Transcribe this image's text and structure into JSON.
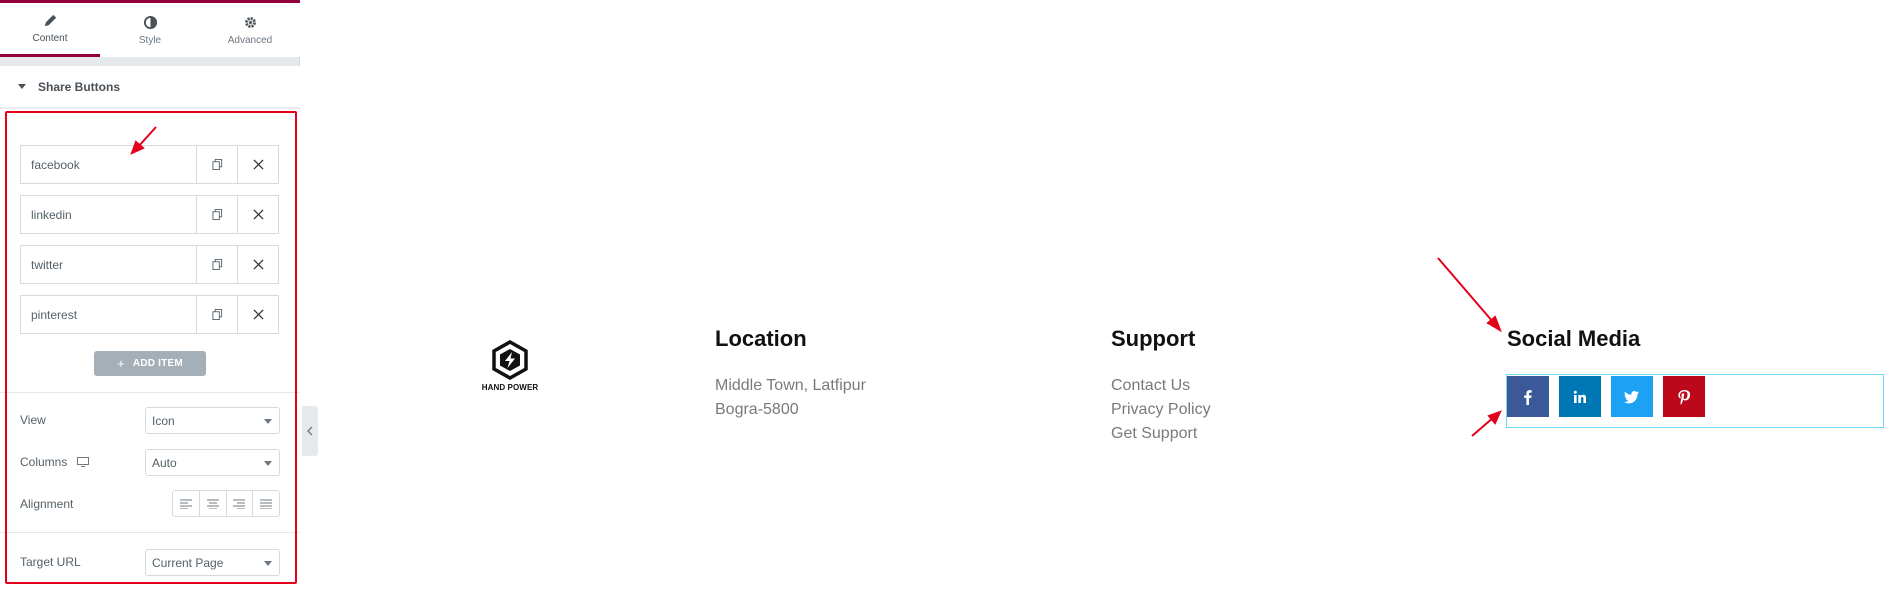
{
  "panel": {
    "tabs": [
      {
        "label": "Content",
        "icon": "pencil-icon",
        "active": true
      },
      {
        "label": "Style",
        "icon": "half-circle-icon",
        "active": false
      },
      {
        "label": "Advanced",
        "icon": "gear-icon",
        "active": false
      }
    ],
    "section_title": "Share Buttons",
    "repeater_items": [
      "facebook",
      "linkedin",
      "twitter",
      "pinterest"
    ],
    "add_item_label": "ADD ITEM",
    "view": {
      "label": "View",
      "value": "Icon"
    },
    "columns": {
      "label": "Columns",
      "value": "Auto"
    },
    "alignment": {
      "label": "Alignment"
    },
    "target_url": {
      "label": "Target URL",
      "value": "Current Page"
    },
    "accent_color": "#93003c",
    "highlight_color": "#e2001a"
  },
  "footer": {
    "brand_text": "HAND POWER",
    "location": {
      "title": "Location",
      "lines": [
        "Middle Town, Latfipur",
        "Bogra-5800"
      ]
    },
    "support": {
      "title": "Support",
      "links": [
        "Contact Us",
        "Privacy Policy",
        "Get Support"
      ]
    },
    "social": {
      "title": "Social Media",
      "buttons": [
        {
          "network": "facebook",
          "icon": "facebook-icon",
          "color": "#3b5998"
        },
        {
          "network": "linkedin",
          "icon": "linkedin-icon",
          "color": "#0077b5"
        },
        {
          "network": "twitter",
          "icon": "twitter-icon",
          "color": "#1da1f2"
        },
        {
          "network": "pinterest",
          "icon": "pinterest-icon",
          "color": "#bd081c"
        }
      ]
    }
  }
}
